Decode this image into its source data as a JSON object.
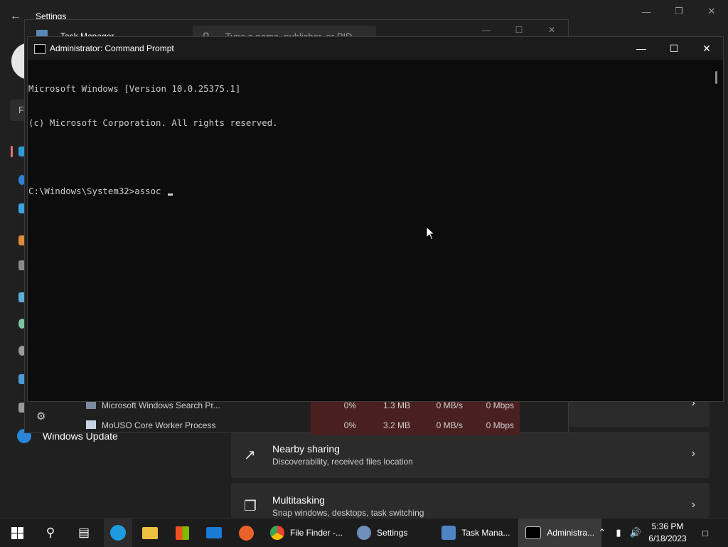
{
  "settings": {
    "title": "Settings",
    "search_fragment": "F",
    "windows_update_label": "Windows Update",
    "cards": [
      {
        "title": "Nearby sharing",
        "subtitle": "Discoverability, received files location"
      },
      {
        "title": "Multitasking",
        "subtitle": "Snap windows, desktops, task switching"
      }
    ]
  },
  "task_manager": {
    "title": "Task Manager",
    "search_placeholder": "Type a name, publisher, or PID",
    "processes": [
      {
        "name": "Microsoft Windows Search Pr...",
        "cpu": "0%",
        "memory": "1.3 MB",
        "disk": "0 MB/s",
        "network": "0 Mbps"
      },
      {
        "name": "MoUSO Core Worker Process",
        "cpu": "0%",
        "memory": "3.2 MB",
        "disk": "0 MB/s",
        "network": "0 Mbps"
      }
    ]
  },
  "command_prompt": {
    "title": "Administrator: Command Prompt",
    "lines": [
      "Microsoft Windows [Version 10.0.25375.1]",
      "(c) Microsoft Corporation. All rights reserved.",
      "",
      "C:\\Windows\\System32>assoc "
    ]
  },
  "taskbar": {
    "apps": [
      {
        "label": "File Finder -...",
        "icon": "chrome-icon"
      },
      {
        "label": "Settings",
        "icon": "gear-icon"
      },
      {
        "label": "Task Mana...",
        "icon": "task-manager-icon"
      },
      {
        "label": "Administra...",
        "icon": "command-prompt-icon"
      }
    ],
    "time": "5:36 PM",
    "date": "6/18/2023"
  },
  "colors": {
    "accent": "#0078d4",
    "terminal_bg": "#0c0c0c",
    "terminal_text": "#cccccc",
    "heat": "#4a1f1f"
  }
}
